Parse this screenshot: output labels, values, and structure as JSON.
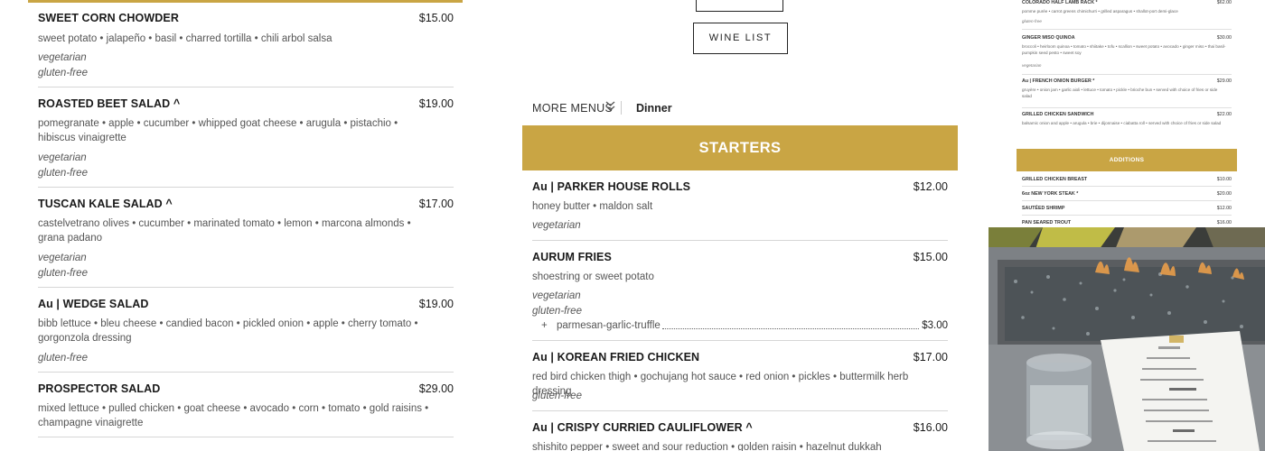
{
  "left_menu": {
    "items": [
      {
        "name": "SWEET CORN CHOWDER",
        "price": "$15.00",
        "desc": "sweet potato • jalapeño • basil • charred tortilla • chili arbol salsa",
        "tags": [
          "vegetarian",
          "gluten-free"
        ]
      },
      {
        "name": "ROASTED BEET SALAD ^",
        "price": "$19.00",
        "desc": "pomegranate • apple • cucumber • whipped goat cheese • arugula • pistachio • hibiscus vinaigrette",
        "tags": [
          "vegetarian",
          "gluten-free"
        ]
      },
      {
        "name": "TUSCAN KALE SALAD ^",
        "price": "$17.00",
        "desc": "castelvetrano olives • cucumber • marinated tomato • lemon • marcona almonds • grana padano",
        "tags": [
          "vegetarian",
          "gluten-free"
        ]
      },
      {
        "name": "Au | WEDGE SALAD",
        "price": "$19.00",
        "desc": "bibb lettuce • bleu cheese • candied bacon • pickled onion • apple • cherry tomato • gorgonzola dressing",
        "tags": [
          "gluten-free"
        ]
      },
      {
        "name": "PROSPECTOR SALAD",
        "price": "$29.00",
        "desc": "mixed lettuce • pulled chicken • goat cheese • avocado • corn • tomato • gold raisins • champagne vinaigrette",
        "tags": []
      }
    ]
  },
  "middle": {
    "wine_list_label": "WINE LIST",
    "more_menus_label": "MORE MENUS",
    "current_menu": "Dinner",
    "section_title": "STARTERS",
    "items": [
      {
        "name": "Au | PARKER HOUSE ROLLS",
        "price": "$12.00",
        "desc": "honey butter • maldon salt",
        "tags": [
          "vegetarian"
        ]
      },
      {
        "name": "AURUM FRIES",
        "price": "$15.00",
        "desc": "shoestring or sweet potato",
        "tags": [
          "vegetarian",
          "gluten-free"
        ],
        "addon": {
          "label": "parmesan-garlic-truffle",
          "price": "$3.00"
        }
      },
      {
        "name": "Au | KOREAN FRIED CHICKEN",
        "price": "$17.00",
        "desc": "red bird chicken thigh • gochujang hot sauce • red onion • pickles • buttermilk herb dressing",
        "tags": [
          "gluten-free"
        ]
      },
      {
        "name": "Au | CRISPY CURRIED CAULIFLOWER ^",
        "price": "$16.00",
        "desc": "shishito pepper • sweet and sour reduction • golden raisin • hazelnut dukkah",
        "tags": []
      }
    ]
  },
  "right_menu": {
    "items": [
      {
        "name": "COLORADO HALF LAMB RACK *",
        "price": "$62.00",
        "desc": "pomme purée • carrot greens chimichurri • grilled asparagus • shallot-port demi-glace",
        "tag": "gluten-free"
      },
      {
        "name": "GINGER MISO QUINOA",
        "price": "$30.00",
        "desc": "broccoli • heirloom quinoa • tomato • shiitake • tofu • scallion • sweet potato • avocado • ginger miso • thai basil-pumpkin seed pesto • sweet soy",
        "tag": "vegetarian"
      },
      {
        "name": "Au | FRENCH ONION BURGER *",
        "price": "$29.00",
        "desc": "gruyère • onion jam • garlic aioli • lettuce • tomato • pickle • brioche bun • served with choice of fries or side salad",
        "tag": ""
      },
      {
        "name": "GRILLED CHICKEN SANDWICH",
        "price": "$22.00",
        "desc": "balsamic onion and apple • arugula • brie • dijonnaise • ciabatta roll • served with choice of fries or side salad",
        "tag": ""
      }
    ],
    "additions_title": "ADDITIONS",
    "additions": [
      {
        "name": "GRILLED CHICKEN BREAST",
        "price": "$10.00"
      },
      {
        "name": "6oz NEW YORK STEAK *",
        "price": "$20.00"
      },
      {
        "name": "SAUTÉED SHRIMP",
        "price": "$12.00"
      },
      {
        "name": "PAN SEARED TROUT",
        "price": "$16.00"
      }
    ]
  },
  "colors": {
    "accent_gold": "#c9a544",
    "text_dark": "#1a1a1a",
    "text_muted": "#555555",
    "rule": "#d6d6d6"
  },
  "icons": {
    "more_menus_chevron": "double-chevron-down-icon"
  }
}
